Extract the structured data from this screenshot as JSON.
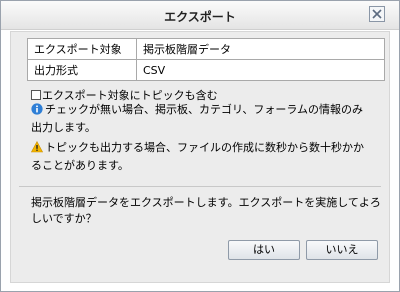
{
  "dialog": {
    "title": "エクスポート",
    "close_icon": "close-icon"
  },
  "properties": [
    {
      "label": "エクスポート対象",
      "value": "掲示板階層データ"
    },
    {
      "label": "出力形式",
      "value": "CSV"
    }
  ],
  "include_topics": {
    "label": "エクスポート対象にトピックも含む",
    "checked": false
  },
  "notes": {
    "info": {
      "icon": "info-icon",
      "text": "チェックが無い場合、掲示板、カテゴリ、フォーラムの情報のみ出力します。"
    },
    "warning": {
      "icon": "warning-icon",
      "text": "トピックも出力する場合、ファイルの作成に数秒から数十秒かかることがあります。"
    }
  },
  "message": "掲示板階層データをエクスポートします。エクスポートを実施してよろしいですか？",
  "buttons": {
    "yes": "はい",
    "no": "いいえ"
  },
  "colors": {
    "info": "#2f7fd6",
    "warning": "#f2b400"
  }
}
